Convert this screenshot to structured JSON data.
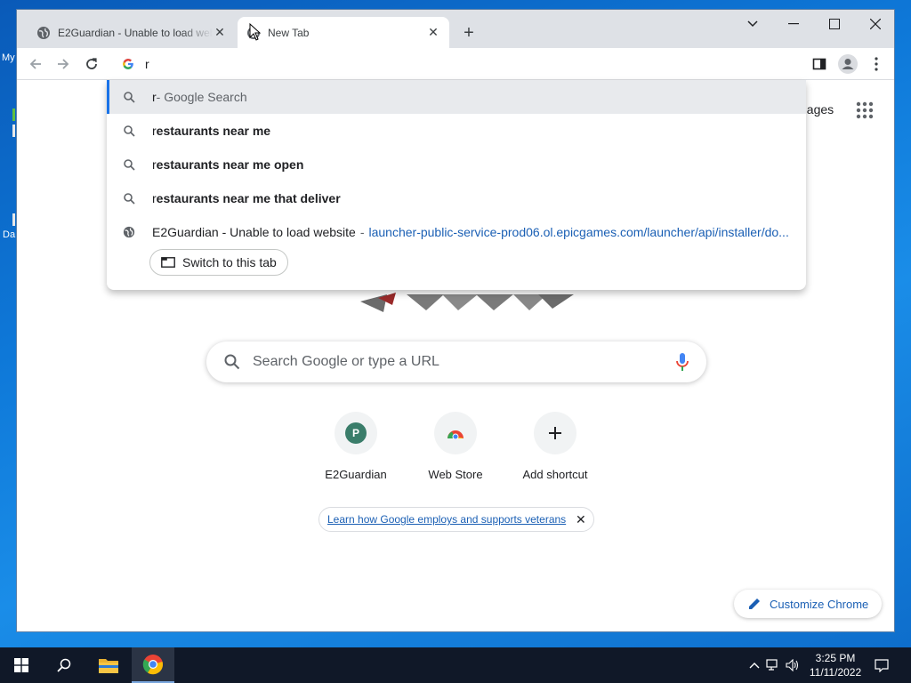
{
  "desktop": {
    "icon_label_1": "My",
    "icon_label_2": "Da"
  },
  "browser": {
    "tabs": [
      {
        "title": "E2Guardian - Unable to load website",
        "active": false
      },
      {
        "title": "New Tab",
        "active": true
      }
    ],
    "omnibox": {
      "value": "r"
    },
    "suggestions": [
      {
        "typed": "r",
        "suffix": " - Google Search",
        "type": "search",
        "selected": true
      },
      {
        "typed": "r",
        "bold": "estaurants near me",
        "type": "search"
      },
      {
        "typed": "r",
        "bold": "estaurants near me open",
        "type": "search"
      },
      {
        "typed": "r",
        "bold": "estaurants near me that deliver",
        "type": "search"
      },
      {
        "title": "E2Guardian - Unable to load website",
        "separator": "-",
        "url": "launcher-public-service-prod06.ol.epicgames.com/launcher/api/installer/do...",
        "type": "history-tab"
      }
    ],
    "switch_tab_label": "Switch to this tab"
  },
  "ntp": {
    "images_link": "nages",
    "search_placeholder": "Search Google or type a URL",
    "shortcuts": [
      {
        "label": "E2Guardian",
        "letter": "P"
      },
      {
        "label": "Web Store"
      },
      {
        "label": "Add shortcut"
      }
    ],
    "promo_text": "Learn how Google employs and supports veterans",
    "customize_label": "Customize Chrome"
  },
  "taskbar": {
    "time": "3:25 PM",
    "date": "11/11/2022"
  },
  "colors": {
    "accent": "#1a73e8",
    "link": "#1a5fb4",
    "e2guardian_avatar": "#3a7d6a"
  }
}
